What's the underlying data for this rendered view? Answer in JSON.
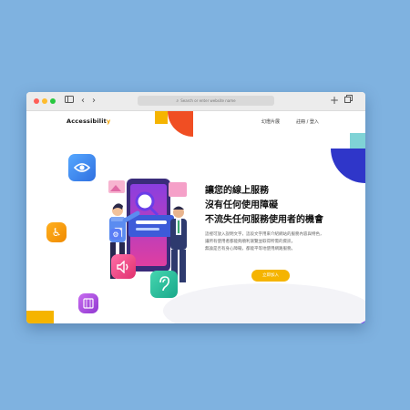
{
  "browser": {
    "url_placeholder": "Search or enter website name",
    "back_icon": "chevron-left-icon",
    "forward_icon": "chevron-right-icon"
  },
  "site": {
    "logo_main": "Accessibilit",
    "logo_accent": "y",
    "nav": [
      "幻燈片展",
      "註冊 / 登入"
    ]
  },
  "hero": {
    "headline": [
      "讓您的線上服務",
      "沒有任何使用障礙",
      "不流失任何服務使用者的機會"
    ],
    "body": [
      "這裡可放入說明文字，這段文字用來介紹網站的服務內容與特色，",
      "讓所有使用者都能夠順利瀏覽並取得所需的資訊，",
      "無論是否有身心障礙，都能平等地使用網路服務。"
    ],
    "cta_label": "立即加入"
  },
  "colors": {
    "accent": "#f5b400",
    "brand_red": "#f04e23",
    "purple": "#6a3de8",
    "teal": "#7fd3d6"
  }
}
